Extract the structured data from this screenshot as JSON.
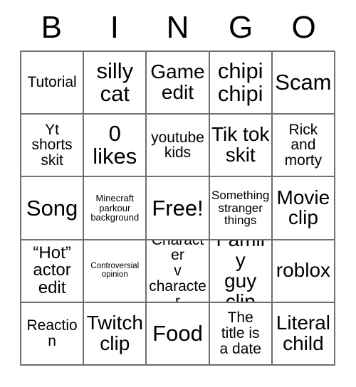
{
  "card": {
    "header_letters": [
      "B",
      "I",
      "N",
      "G",
      "O"
    ],
    "rows": [
      [
        {
          "text": "Tutorial",
          "size": "md"
        },
        {
          "text": "silly\ncat",
          "size": "xxl"
        },
        {
          "text": "Game\nedit",
          "size": "xl"
        },
        {
          "text": "chipi\nchipi",
          "size": "xxl"
        },
        {
          "text": "Scam",
          "size": "xxl"
        }
      ],
      [
        {
          "text": "Yt\nshorts\nskit",
          "size": "md"
        },
        {
          "text": "0\nlikes",
          "size": "xxl"
        },
        {
          "text": "youtube\nkids",
          "size": "md"
        },
        {
          "text": "Tik tok\nskit",
          "size": "xl"
        },
        {
          "text": "Rick\nand\nmorty",
          "size": "md"
        }
      ],
      [
        {
          "text": "Song",
          "size": "xxl"
        },
        {
          "text": "Minecraft\nparkour\nbackground",
          "size": "xs"
        },
        {
          "text": "Free!",
          "size": "xxl"
        },
        {
          "text": "Something\nstranger\nthings",
          "size": "sm"
        },
        {
          "text": "Movie\nclip",
          "size": "xl"
        }
      ],
      [
        {
          "text": "“Hot”\nactor\nedit",
          "size": "lg"
        },
        {
          "text": "Controversial\nopinion",
          "size": "xxs"
        },
        {
          "text": "Character\nv\ncharacter",
          "size": "md"
        },
        {
          "text": "Family\nguy\nclip",
          "size": "xl"
        },
        {
          "text": "roblox",
          "size": "xl"
        }
      ],
      [
        {
          "text": "Reaction",
          "size": "md"
        },
        {
          "text": "Twitch\nclip",
          "size": "xl"
        },
        {
          "text": "Food",
          "size": "xxl"
        },
        {
          "text": "The\ntitle is\na date",
          "size": "md"
        },
        {
          "text": "Literal\nchild",
          "size": "xl"
        }
      ]
    ]
  },
  "colors": {
    "background": "#ffffff",
    "text": "#000000",
    "grid_line": "#6f6f6f"
  }
}
